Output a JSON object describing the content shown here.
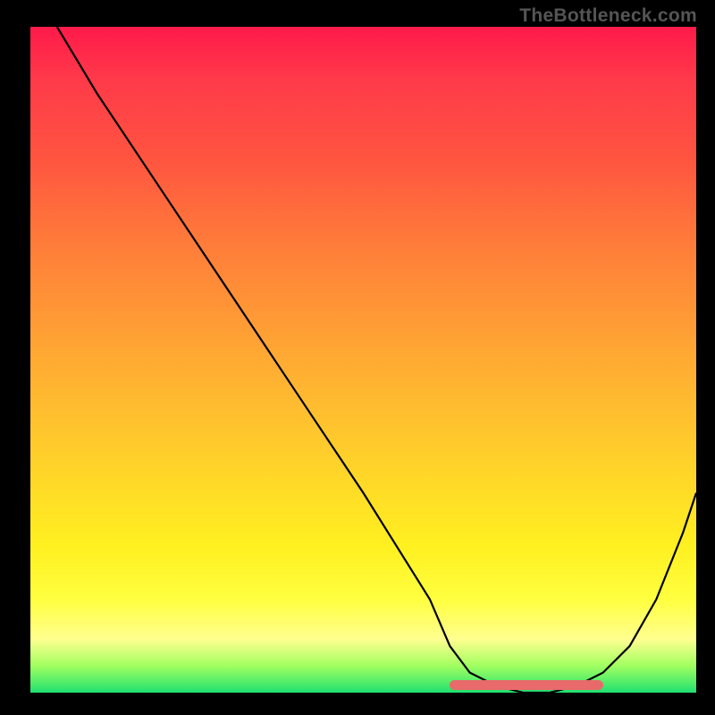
{
  "watermark": "TheBottleneck.com",
  "chart_data": {
    "type": "line",
    "title": "",
    "xlabel": "",
    "ylabel": "",
    "xlim": [
      0,
      100
    ],
    "ylim": [
      0,
      100
    ],
    "series": [
      {
        "name": "curve",
        "x": [
          4,
          10,
          20,
          30,
          40,
          50,
          60,
          63,
          66,
          70,
          74,
          78,
          82,
          86,
          90,
          94,
          98,
          100
        ],
        "values": [
          100,
          90,
          75,
          60,
          45,
          30,
          14,
          7,
          3,
          1,
          0,
          0,
          1,
          3,
          7,
          14,
          24,
          30
        ]
      }
    ],
    "accent_range_x": [
      63,
      86
    ],
    "accent_color": "#e86a6a",
    "gradient_top": "#ff1a4a",
    "gradient_bottom": "#20e070"
  }
}
